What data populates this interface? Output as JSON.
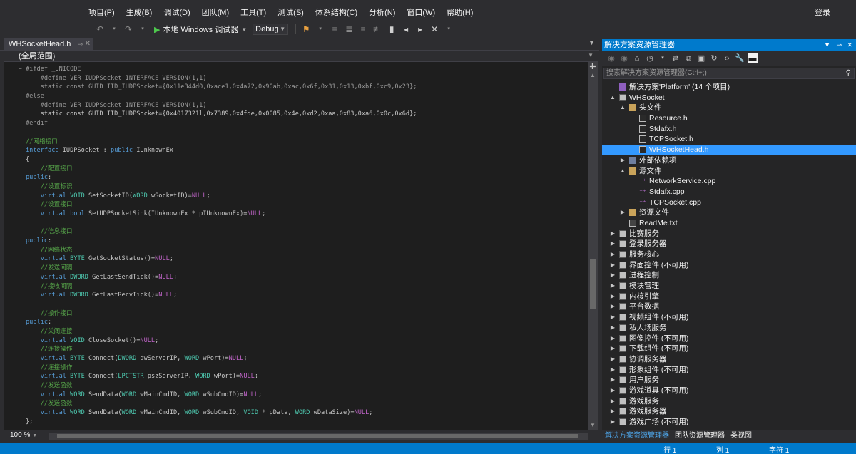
{
  "menu": [
    "项目(P)",
    "生成(B)",
    "调试(D)",
    "团队(M)",
    "工具(T)",
    "测试(S)",
    "体系结构(C)",
    "分析(N)",
    "窗口(W)",
    "帮助(H)"
  ],
  "login_label": "登录",
  "toolbar": {
    "run_label": "本地 Windows 调试器",
    "config_value": "Debug",
    "icons": [
      "undo-icon",
      "redo-icon",
      "start-debug-icon",
      "bookmark-icon",
      "comment-icon"
    ]
  },
  "document_tab": {
    "title": "WHSocketHead.h"
  },
  "scope": {
    "value": "(全局范围)"
  },
  "code_lines": [
    {
      "fold": "−",
      "parts": [
        [
          "pp",
          "#ifdef _UNICODE"
        ]
      ]
    },
    {
      "parts": [
        [
          "pp",
          "    #define VER_IUDPSocket INTERFACE_VERSION(1,1)"
        ]
      ]
    },
    {
      "parts": [
        [
          "pp",
          "    static const GUID IID_IUDPSocket={0x11e344d0,0xace1,0x4a72,0x90ab,0xac,0x6f,0x31,0x13,0xbf,0xc9,0x23};"
        ]
      ]
    },
    {
      "fold": "−",
      "parts": [
        [
          "pp",
          "#else"
        ]
      ]
    },
    {
      "parts": [
        [
          "pp",
          "    #define VER_IUDPSocket INTERFACE_VERSION(1,1)"
        ]
      ]
    },
    {
      "parts": [
        [
          "txt",
          "    static const GUID IID_IUDPSocket={0x4017321l,0x7389,0x4fde,0x0085,0x4e,0xd2,0xaa,0x83,0xa6,0x0c,0x6d};"
        ]
      ]
    },
    {
      "parts": [
        [
          "pp",
          "#endif"
        ]
      ]
    },
    {
      "parts": [
        [
          "txt",
          ""
        ]
      ]
    },
    {
      "parts": [
        [
          "cm",
          "//网络接口"
        ]
      ]
    },
    {
      "fold": "−",
      "parts": [
        [
          "kw",
          "interface"
        ],
        [
          "txt",
          " IUDPSocket : "
        ],
        [
          "kw",
          "public"
        ],
        [
          "txt",
          " IUnknownEx"
        ]
      ]
    },
    {
      "parts": [
        [
          "txt",
          "{"
        ]
      ]
    },
    {
      "parts": [
        [
          "cm",
          "    //配置接口"
        ]
      ]
    },
    {
      "parts": [
        [
          "kw",
          "public"
        ],
        [
          "txt",
          ":"
        ]
      ]
    },
    {
      "parts": [
        [
          "cm",
          "    //设置标识"
        ]
      ]
    },
    {
      "parts": [
        [
          "kw",
          "    virtual "
        ],
        [
          "ty",
          "VOID"
        ],
        [
          "txt",
          " SetSocketID("
        ],
        [
          "ty",
          "WORD"
        ],
        [
          "txt",
          " wSocketID)="
        ],
        [
          "mc",
          "NULL"
        ],
        [
          "txt",
          ";"
        ]
      ]
    },
    {
      "parts": [
        [
          "cm",
          "    //设置接口"
        ]
      ]
    },
    {
      "parts": [
        [
          "kw",
          "    virtual bool"
        ],
        [
          "txt",
          " SetUDPSocketSink(IUnknownEx * pIUnknownEx)="
        ],
        [
          "mc",
          "NULL"
        ],
        [
          "txt",
          ";"
        ]
      ]
    },
    {
      "parts": [
        [
          "txt",
          ""
        ]
      ]
    },
    {
      "parts": [
        [
          "cm",
          "    //信息接口"
        ]
      ]
    },
    {
      "parts": [
        [
          "kw",
          "public"
        ],
        [
          "txt",
          ":"
        ]
      ]
    },
    {
      "parts": [
        [
          "cm",
          "    //网络状态"
        ]
      ]
    },
    {
      "parts": [
        [
          "kw",
          "    virtual "
        ],
        [
          "ty",
          "BYTE"
        ],
        [
          "txt",
          " GetSocketStatus()="
        ],
        [
          "mc",
          "NULL"
        ],
        [
          "txt",
          ";"
        ]
      ]
    },
    {
      "parts": [
        [
          "cm",
          "    //发送间隔"
        ]
      ]
    },
    {
      "parts": [
        [
          "kw",
          "    virtual "
        ],
        [
          "ty",
          "DWORD"
        ],
        [
          "txt",
          " GetLastSendTick()="
        ],
        [
          "mc",
          "NULL"
        ],
        [
          "txt",
          ";"
        ]
      ]
    },
    {
      "parts": [
        [
          "cm",
          "    //接收间隔"
        ]
      ]
    },
    {
      "parts": [
        [
          "kw",
          "    virtual "
        ],
        [
          "ty",
          "DWORD"
        ],
        [
          "txt",
          " GetLastRecvTick()="
        ],
        [
          "mc",
          "NULL"
        ],
        [
          "txt",
          ";"
        ]
      ]
    },
    {
      "parts": [
        [
          "txt",
          ""
        ]
      ]
    },
    {
      "parts": [
        [
          "cm",
          "    //操作接口"
        ]
      ]
    },
    {
      "parts": [
        [
          "kw",
          "public"
        ],
        [
          "txt",
          ":"
        ]
      ]
    },
    {
      "parts": [
        [
          "cm",
          "    //关闭连接"
        ]
      ]
    },
    {
      "parts": [
        [
          "kw",
          "    virtual "
        ],
        [
          "ty",
          "VOID"
        ],
        [
          "txt",
          " CloseSocket()="
        ],
        [
          "mc",
          "NULL"
        ],
        [
          "txt",
          ";"
        ]
      ]
    },
    {
      "parts": [
        [
          "cm",
          "    //连接操作"
        ]
      ]
    },
    {
      "parts": [
        [
          "kw",
          "    virtual "
        ],
        [
          "ty",
          "BYTE"
        ],
        [
          "txt",
          " Connect("
        ],
        [
          "ty",
          "DWORD"
        ],
        [
          "txt",
          " dwServerIP, "
        ],
        [
          "ty",
          "WORD"
        ],
        [
          "txt",
          " wPort)="
        ],
        [
          "mc",
          "NULL"
        ],
        [
          "txt",
          ";"
        ]
      ]
    },
    {
      "parts": [
        [
          "cm",
          "    //连接操作"
        ]
      ]
    },
    {
      "parts": [
        [
          "kw",
          "    virtual "
        ],
        [
          "ty",
          "BYTE"
        ],
        [
          "txt",
          " Connect("
        ],
        [
          "ty",
          "LPCTSTR"
        ],
        [
          "txt",
          " pszServerIP, "
        ],
        [
          "ty",
          "WORD"
        ],
        [
          "txt",
          " wPort)="
        ],
        [
          "mc",
          "NULL"
        ],
        [
          "txt",
          ";"
        ]
      ]
    },
    {
      "parts": [
        [
          "cm",
          "    //发送函数"
        ]
      ]
    },
    {
      "parts": [
        [
          "kw",
          "    virtual "
        ],
        [
          "ty",
          "WORD"
        ],
        [
          "txt",
          " SendData("
        ],
        [
          "ty",
          "WORD"
        ],
        [
          "txt",
          " wMainCmdID, "
        ],
        [
          "ty",
          "WORD"
        ],
        [
          "txt",
          " wSubCmdID)="
        ],
        [
          "mc",
          "NULL"
        ],
        [
          "txt",
          ";"
        ]
      ]
    },
    {
      "parts": [
        [
          "cm",
          "    //发送函数"
        ]
      ]
    },
    {
      "parts": [
        [
          "kw",
          "    virtual "
        ],
        [
          "ty",
          "WORD"
        ],
        [
          "txt",
          " SendData("
        ],
        [
          "ty",
          "WORD"
        ],
        [
          "txt",
          " wMainCmdID, "
        ],
        [
          "ty",
          "WORD"
        ],
        [
          "txt",
          " wSubCmdID, "
        ],
        [
          "ty",
          "VOID"
        ],
        [
          "txt",
          " * pData, "
        ],
        [
          "ty",
          "WORD"
        ],
        [
          "txt",
          " wDataSize)="
        ],
        [
          "mc",
          "NULL"
        ],
        [
          "txt",
          ";"
        ]
      ]
    },
    {
      "parts": [
        [
          "txt",
          "};"
        ]
      ]
    }
  ],
  "editor_footer": {
    "zoom": "100 %"
  },
  "solution_explorer": {
    "title": "解决方案资源管理器",
    "search_placeholder": "搜索解决方案资源管理器(Ctrl+;)",
    "tree": [
      {
        "level": 0,
        "exp": "",
        "icon": "sol",
        "label": "解决方案'Platform' (14 个项目)"
      },
      {
        "level": 0,
        "exp": "▲",
        "icon": "proj",
        "label": "WHSocket"
      },
      {
        "level": 1,
        "exp": "▲",
        "icon": "folder",
        "label": "头文件"
      },
      {
        "level": 2,
        "exp": "",
        "icon": "file",
        "label": "Resource.h"
      },
      {
        "level": 2,
        "exp": "",
        "icon": "file",
        "label": "Stdafx.h"
      },
      {
        "level": 2,
        "exp": "",
        "icon": "file",
        "label": "TCPSocket.h"
      },
      {
        "level": 2,
        "exp": "",
        "icon": "file",
        "label": "WHSocketHead.h",
        "selected": true
      },
      {
        "level": 1,
        "exp": "▶",
        "icon": "dep",
        "label": "外部依赖项"
      },
      {
        "level": 1,
        "exp": "▲",
        "icon": "folder",
        "label": "源文件"
      },
      {
        "level": 2,
        "exp": "",
        "icon": "cpp",
        "label": "NetworkService.cpp"
      },
      {
        "level": 2,
        "exp": "",
        "icon": "cpp",
        "label": "Stdafx.cpp"
      },
      {
        "level": 2,
        "exp": "",
        "icon": "cpp",
        "label": "TCPSocket.cpp"
      },
      {
        "level": 1,
        "exp": "▶",
        "icon": "folder",
        "label": "资源文件"
      },
      {
        "level": 1,
        "exp": "",
        "icon": "txt",
        "label": "ReadMe.txt"
      },
      {
        "level": 0,
        "exp": "▶",
        "icon": "proj",
        "label": "比赛服务"
      },
      {
        "level": 0,
        "exp": "▶",
        "icon": "proj",
        "label": "登录服务器"
      },
      {
        "level": 0,
        "exp": "▶",
        "icon": "proj",
        "label": "服务核心"
      },
      {
        "level": 0,
        "exp": "▶",
        "icon": "proj",
        "label": "界面控件 (不可用)"
      },
      {
        "level": 0,
        "exp": "▶",
        "icon": "proj",
        "label": "进程控制"
      },
      {
        "level": 0,
        "exp": "▶",
        "icon": "proj",
        "label": "模块管理"
      },
      {
        "level": 0,
        "exp": "▶",
        "icon": "proj",
        "label": "内核引擎"
      },
      {
        "level": 0,
        "exp": "▶",
        "icon": "proj",
        "label": "平台数据"
      },
      {
        "level": 0,
        "exp": "▶",
        "icon": "proj",
        "label": "视频组件 (不可用)"
      },
      {
        "level": 0,
        "exp": "▶",
        "icon": "proj",
        "label": "私人场服务"
      },
      {
        "level": 0,
        "exp": "▶",
        "icon": "proj",
        "label": "图像控件 (不可用)"
      },
      {
        "level": 0,
        "exp": "▶",
        "icon": "proj",
        "label": "下载组件 (不可用)"
      },
      {
        "level": 0,
        "exp": "▶",
        "icon": "proj",
        "label": "协调服务器"
      },
      {
        "level": 0,
        "exp": "▶",
        "icon": "proj",
        "label": "形象组件 (不可用)"
      },
      {
        "level": 0,
        "exp": "▶",
        "icon": "proj",
        "label": "用户服务"
      },
      {
        "level": 0,
        "exp": "▶",
        "icon": "proj",
        "label": "游戏道具 (不可用)"
      },
      {
        "level": 0,
        "exp": "▶",
        "icon": "proj",
        "label": "游戏服务"
      },
      {
        "level": 0,
        "exp": "▶",
        "icon": "proj",
        "label": "游戏服务器"
      },
      {
        "level": 0,
        "exp": "▶",
        "icon": "proj",
        "label": "游戏广场 (不可用)"
      }
    ],
    "bottom_tabs": [
      "解决方案资源管理器",
      "团队资源管理器",
      "类视图"
    ]
  },
  "status_bar": {
    "line": "行 1",
    "col": "列 1",
    "ch": "字符 1"
  },
  "colors": {
    "accent": "#007acc",
    "selection": "#3399ff",
    "keyword": "#569cd6",
    "comment": "#57a64a"
  }
}
